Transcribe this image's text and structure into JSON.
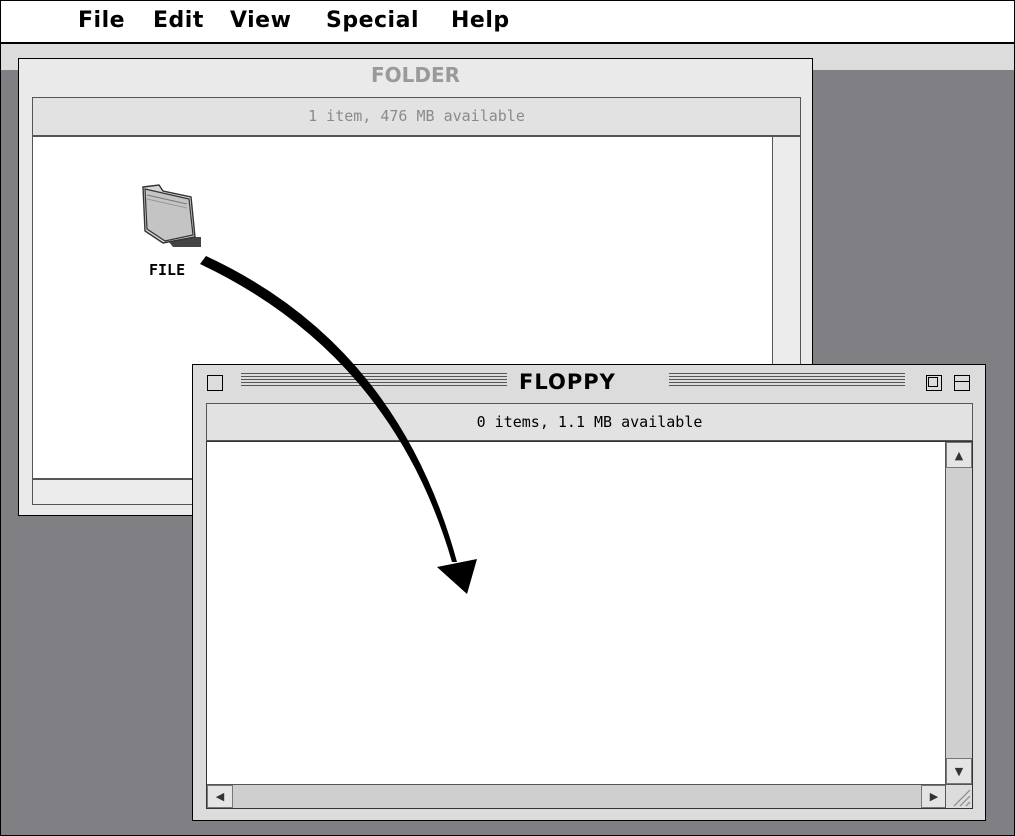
{
  "menubar": {
    "items": [
      {
        "label": "File"
      },
      {
        "label": "Edit"
      },
      {
        "label": "View"
      },
      {
        "label": "Special"
      },
      {
        "label": "Help"
      }
    ]
  },
  "folder_window": {
    "title": "FOLDER",
    "info": "1 item, 476 MB available",
    "items": [
      {
        "label": "FILE",
        "icon": "folder-icon"
      }
    ]
  },
  "floppy_window": {
    "title": "FLOPPY",
    "info": "0 items, 1.1 MB available"
  },
  "colors": {
    "desktop": "#808084",
    "window": "#dcdcdc",
    "content": "#ffffff"
  }
}
